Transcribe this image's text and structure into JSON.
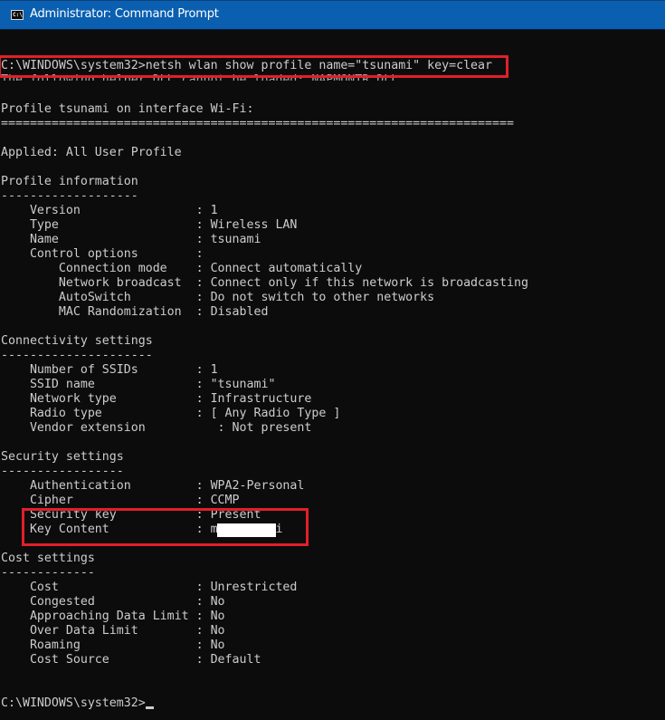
{
  "window": {
    "title": "Administrator: Command Prompt",
    "icon": "cmd-icon",
    "icon_glyph": "C:\\_"
  },
  "console": {
    "prompt": "C:\\WINDOWS\\system32>",
    "command": "netsh wlan show profile name=\"tsunami\" key=clear",
    "lines": {
      "cmd": "C:\\WINDOWS\\system32>netsh wlan show profile name=\"tsunami\" key=clear",
      "warn": "The following helper DLL cannot be loaded: NAPMONTR.DLL.",
      "profile_header": "Profile tsunami on interface Wi-Fi:",
      "profile_rule": "=======================================================================",
      "applied": "Applied: All User Profile",
      "profile_info": "Profile information",
      "profile_info_rule": "-------------------",
      "version": "    Version                : 1",
      "type": "    Type                   : Wireless LAN",
      "name": "    Name                   : tsunami",
      "control": "    Control options        :",
      "conn_mode": "        Connection mode    : Connect automatically",
      "net_bcast": "        Network broadcast  : Connect only if this network is broadcasting",
      "autoswitch": "        AutoSwitch         : Do not switch to other networks",
      "mac_rand": "        MAC Randomization  : Disabled",
      "connectivity": "Connectivity settings",
      "connectivity_rule": "---------------------",
      "num_ssids": "    Number of SSIDs        : 1",
      "ssid_name": "    SSID name              : \"tsunami\"",
      "net_type": "    Network type           : Infrastructure",
      "radio_type": "    Radio type             : [ Any Radio Type ]",
      "vendor_ext": "    Vendor extension          : Not present",
      "security": "Security settings",
      "security_rule": "-----------------",
      "auth": "    Authentication         : WPA2-Personal",
      "cipher": "    Cipher                 : CCMP",
      "sec_key": "    Security key           : Present",
      "key_content": "    Key Content            : m        i",
      "cost": "Cost settings",
      "cost_rule": "-------------",
      "cost_val": "    Cost                   : Unrestricted",
      "congested": "    Congested              : No",
      "approaching": "    Approaching Data Limit : No",
      "over_limit": "    Over Data Limit        : No",
      "roaming": "    Roaming                : No",
      "cost_source": "    Cost Source            : Default",
      "final_prompt": "C:\\WINDOWS\\system32>"
    }
  },
  "annotations": {
    "highlight_color": "#e0202a",
    "highlighted": [
      "command",
      "security-key-and-key-content"
    ],
    "redacted": "key-content-value"
  }
}
